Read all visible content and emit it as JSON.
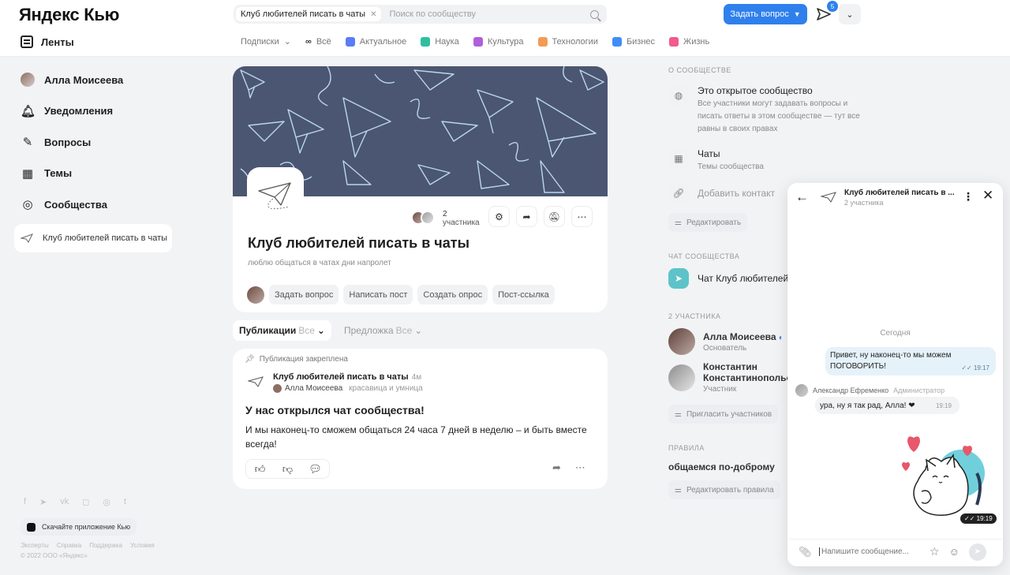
{
  "header": {
    "logo": "Яндекс Кью",
    "feeds_label": "Ленты",
    "search_chip": "Клуб любителей писать в чаты",
    "search_placeholder": "Поиск по сообществу",
    "ask_button": "Задать вопрос",
    "notif_count": "5"
  },
  "categories": [
    {
      "label": "Подписки",
      "color": "#ffffff"
    },
    {
      "label": "Всё",
      "color": "#ffffff"
    },
    {
      "label": "Актуальное",
      "color": "#5b7cf5"
    },
    {
      "label": "Наука",
      "color": "#2fbf9f"
    },
    {
      "label": "Культура",
      "color": "#b15fd8"
    },
    {
      "label": "Технологии",
      "color": "#f29b55"
    },
    {
      "label": "Бизнес",
      "color": "#3e8ef7"
    },
    {
      "label": "Жизнь",
      "color": "#f05a8c"
    }
  ],
  "sidebar": {
    "items": [
      {
        "label": "Алла Моисеева",
        "icon": "avatar"
      },
      {
        "label": "Уведомления",
        "icon": "bell-icon"
      },
      {
        "label": "Вопросы",
        "icon": "pencil-icon"
      },
      {
        "label": "Темы",
        "icon": "grid-icon"
      },
      {
        "label": "Сообщества",
        "icon": "communities-icon"
      },
      {
        "label": "Клуб любителей писать в чаты",
        "icon": "paper-plane-icon"
      }
    ],
    "socials": [
      "f",
      "➤",
      "vk",
      "◻",
      "◎",
      "t"
    ],
    "app_button": "Скачайте приложение Кью",
    "links": [
      "Эксперты",
      "Справка",
      "Поддержка",
      "Условия",
      "© 2022 ООО «Яндекс»"
    ]
  },
  "community": {
    "members_count": "2",
    "members_word": "участника",
    "title": "Клуб любителей писать в чаты",
    "subtitle": "люблю общаться в чатах дни напролет",
    "actions": [
      "Задать вопрос",
      "Написать пост",
      "Создать опрос",
      "Пост-ссылка"
    ]
  },
  "tabs": [
    {
      "label": "Публикации",
      "filter": "Все"
    },
    {
      "label": "Предложка",
      "filter": "Все"
    }
  ],
  "post": {
    "pinned": "Публикация закреплена",
    "community": "Клуб любителей писать в чаты",
    "time": "4м",
    "author": "Алла Моисеева",
    "author_meta": "красавица и умница",
    "title": "У нас открылся чат сообщества!",
    "body": "И мы наконец-то сможем общаться 24 часа 7 дней в неделю – и быть вместе всегда!"
  },
  "right": {
    "about_header": "О сообществе",
    "open_title": "Это открытое сообщество",
    "open_desc": "Все участники могут задавать вопросы и писать ответы в этом сообществе — тут все равны в своих правах",
    "chats_title": "Чаты",
    "chats_desc": "Темы сообщества",
    "add_contact": "Добавить контакт",
    "edit": "Редактировать",
    "chat_header": "Чат сообщества",
    "chat_name": "Чат Клуб любителей",
    "members_header": "2 участника",
    "members": [
      {
        "name": "Алла Моисеева",
        "role": "Основатель"
      },
      {
        "name": "Константин Константинопольский",
        "role": "Участник"
      }
    ],
    "invite": "Пригласить участников",
    "rules_header": "Правила",
    "rules_text": "общаемся по-доброму",
    "edit_rules": "Редактировать правила"
  },
  "chat": {
    "title": "Клуб любителей писать в ...",
    "subtitle": "2 участника",
    "date": "Сегодня",
    "out_text": "Привет, ну наконец-то мы можем ПОГОВОРИТЬ!",
    "out_time": "19:17",
    "sender": "Александр Ефременко",
    "sender_role": "Администратор",
    "in_text": "ура, ну я так рад, Алла! ❤",
    "in_time": "19:19",
    "sticker_time": "19:19",
    "input_placeholder": "Напишите сообщение..."
  }
}
